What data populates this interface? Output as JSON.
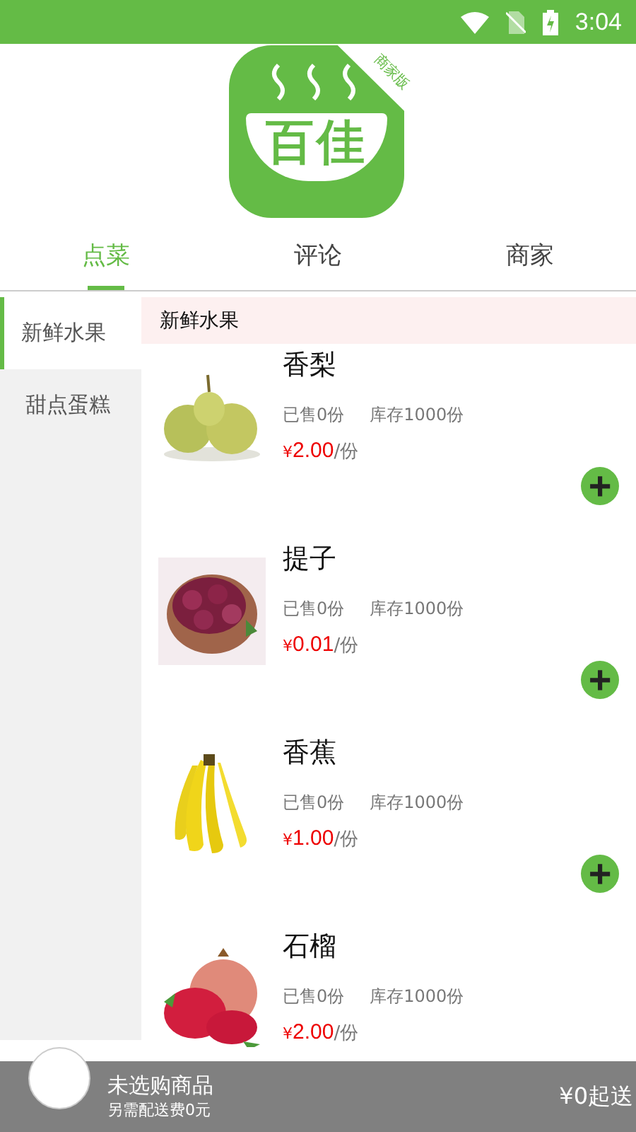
{
  "status_bar": {
    "time": "3:04"
  },
  "logo": {
    "title": "百佳",
    "badge": "商家版"
  },
  "tabs": [
    {
      "label": "点菜",
      "selected": true
    },
    {
      "label": "评论",
      "selected": false
    },
    {
      "label": "商家",
      "selected": false
    }
  ],
  "sidebar": {
    "items": [
      {
        "label": "新鲜水果",
        "selected": true
      },
      {
        "label": "甜点蛋糕",
        "selected": false
      }
    ]
  },
  "section_header": "新鲜水果",
  "products": [
    {
      "name": "香梨",
      "sold": "已售0份",
      "stock": "库存1000份",
      "currency": "¥",
      "price": "2.00",
      "unit": "/份",
      "add": "+"
    },
    {
      "name": "提子",
      "sold": "已售0份",
      "stock": "库存1000份",
      "currency": "¥",
      "price": "0.01",
      "unit": "/份",
      "add": "+"
    },
    {
      "name": "香蕉",
      "sold": "已售0份",
      "stock": "库存1000份",
      "currency": "¥",
      "price": "1.00",
      "unit": "/份",
      "add": "+"
    },
    {
      "name": "石榴",
      "sold": "已售0份",
      "stock": "库存1000份",
      "currency": "¥",
      "price": "2.00",
      "unit": "/份"
    }
  ],
  "cart_bar": {
    "title": "未选购商品",
    "subtitle": "另需配送费0元",
    "minimum": "¥0起送"
  }
}
